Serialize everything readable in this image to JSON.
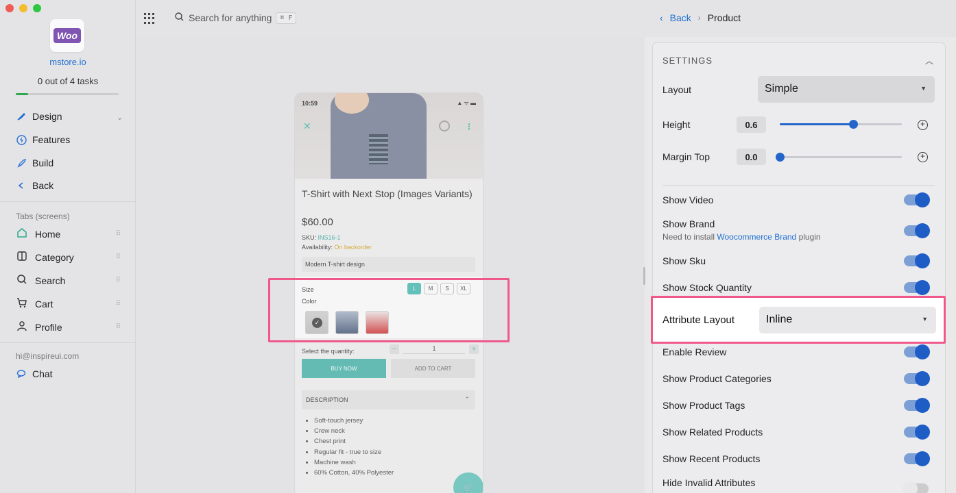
{
  "sidebar": {
    "logo_text": "Woo",
    "store": "mstore.io",
    "tasks": "0 out of 4 tasks",
    "tasks_progress": 0.12,
    "nav": [
      {
        "label": "Design",
        "icon": "brush-icon"
      },
      {
        "label": "Features",
        "icon": "bolt-icon"
      },
      {
        "label": "Build",
        "icon": "rocket-icon"
      },
      {
        "label": "Back",
        "icon": "chevron-left-icon"
      }
    ],
    "tabs_heading": "Tabs (screens)",
    "tabs": [
      {
        "label": "Home",
        "icon": "home-icon"
      },
      {
        "label": "Category",
        "icon": "columns-icon"
      },
      {
        "label": "Search",
        "icon": "search-icon"
      },
      {
        "label": "Cart",
        "icon": "cart-icon"
      },
      {
        "label": "Profile",
        "icon": "user-icon"
      }
    ],
    "email": "hi@inspireui.com",
    "chat": "Chat"
  },
  "topbar": {
    "search_placeholder": "Search for anything",
    "shortcut": "⌘ F"
  },
  "breadcrumb": {
    "back": "Back",
    "current": "Product"
  },
  "phone": {
    "time": "10:59",
    "status_icons": "▲ ᯤ ▬",
    "title": "T-Shirt with Next Stop (Images Variants)",
    "price": "$60.00",
    "sku_label": "SKU:",
    "sku": "INS16-1",
    "availability_label": "Availability:",
    "availability": "On backorder",
    "short_desc": "Modern T-shirt design",
    "size_label": "Size",
    "color_label": "Color",
    "sizes": [
      "L",
      "M",
      "S",
      "XL"
    ],
    "selected_size": "L",
    "qty_label": "Select the quantity:",
    "qty": "1",
    "buy_now": "BUY NOW",
    "add_to_cart": "ADD TO CART",
    "description_heading": "DESCRIPTION",
    "bullets": [
      "Soft-touch jersey",
      "Crew neck",
      "Chest print",
      "Regular fit - true to size",
      "Machine wash",
      "60% Cotton, 40% Polyester"
    ]
  },
  "settings": {
    "heading": "SETTINGS",
    "layout_label": "Layout",
    "layout_value": "Simple",
    "height_label": "Height",
    "height_value": "0.6",
    "height_fraction": 0.6,
    "margin_label": "Margin Top",
    "margin_value": "0.0",
    "margin_fraction": 0.0,
    "toggles": [
      {
        "label": "Show Video",
        "on": true
      },
      {
        "label": "Show Brand",
        "on": true
      },
      {
        "label": "Show Sku",
        "on": true
      },
      {
        "label": "Show Stock Quantity",
        "on": true
      },
      {
        "label": "Enable Review",
        "on": true
      },
      {
        "label": "Show Product Categories",
        "on": true
      },
      {
        "label": "Show Product Tags",
        "on": true
      },
      {
        "label": "Show Related Products",
        "on": true
      },
      {
        "label": "Show Recent Products",
        "on": true
      },
      {
        "label": "Hide Invalid Attributes",
        "on": false
      }
    ],
    "brand_note_prefix": "Need to install",
    "brand_note_link": "Woocommerce Brand",
    "brand_note_suffix": "plugin",
    "attribute_layout_label": "Attribute Layout",
    "attribute_layout_value": "Inline"
  },
  "colors": {
    "accent": "#1e5dc6",
    "highlight": "#f0588a",
    "teal": "#3cb8ad"
  }
}
